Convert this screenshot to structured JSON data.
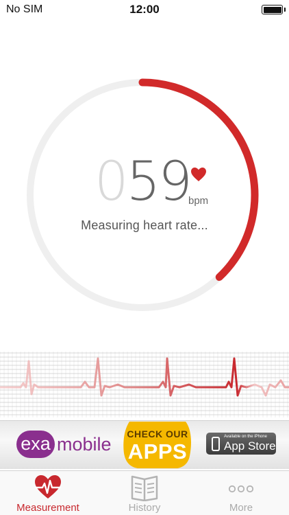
{
  "status_bar": {
    "carrier": "No SIM",
    "time": "12:00",
    "battery_level": 1.0
  },
  "gauge": {
    "progress": 0.38,
    "track_color": "#efefef",
    "progress_color": "#d12a2a"
  },
  "reading": {
    "leading_digit": "0",
    "value": "59",
    "unit": "bpm",
    "status": "Measuring heart rate...",
    "heart_icon": "heart-icon"
  },
  "ecg": {
    "line_color": "#c8282e",
    "grid_color": "#b5b5b5"
  },
  "ad": {
    "exa": "exa",
    "mobile": "mobile",
    "check_our": "CHECK OUR",
    "apps": "APPS",
    "appstore_small": "Available on the iPhone",
    "appstore_big": "App Store"
  },
  "tabs": [
    {
      "label": "Measurement",
      "icon": "heart-pulse-icon",
      "active": true
    },
    {
      "label": "History",
      "icon": "book-icon",
      "active": false
    },
    {
      "label": "More",
      "icon": "more-dots-icon",
      "active": false
    }
  ]
}
